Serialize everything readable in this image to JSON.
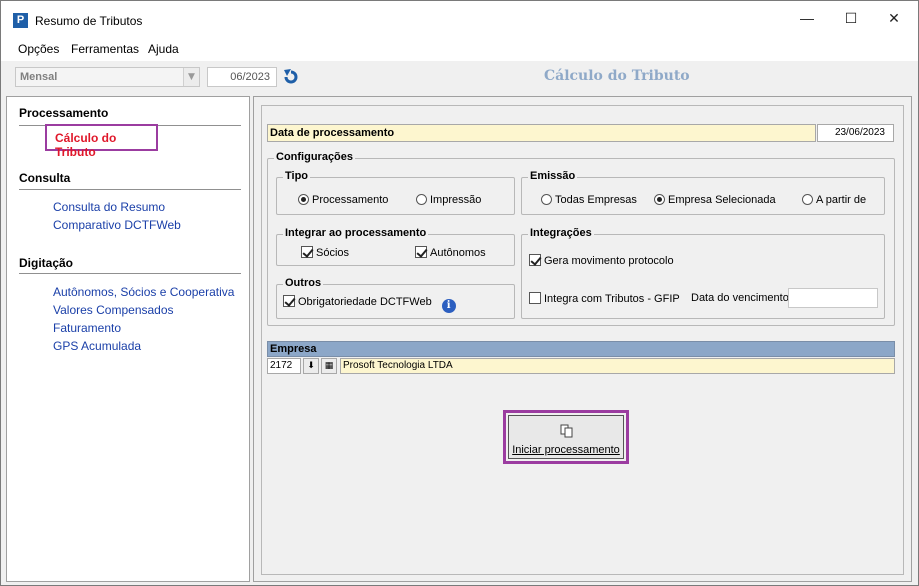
{
  "window": {
    "title": "Resumo de Tributos",
    "app_icon_glyph": "P",
    "minimize_glyph": "—",
    "maximize_glyph": "☐",
    "close_glyph": "✕"
  },
  "menu": [
    "Opções",
    "Ferramentas",
    "Ajuda"
  ],
  "toolbar": {
    "frequency": "Mensal",
    "period": "06/2023",
    "page_title": "Cálculo do Tributo"
  },
  "sidebar": {
    "sections": [
      {
        "title": "Processamento",
        "items": [
          "Cálculo do Tributo"
        ]
      },
      {
        "title": "Consulta",
        "items": [
          "Consulta do Resumo",
          "Comparativo DCTFWeb"
        ]
      },
      {
        "title": "Digitação",
        "items": [
          "Autônomos, Sócios e Cooperativa",
          "Valores Compensados",
          "Faturamento",
          "GPS Acumulada"
        ]
      }
    ],
    "active_item": "Cálculo do Tributo"
  },
  "main": {
    "date_label": "Data de processamento",
    "date_value": "23/06/2023",
    "config_title": "Configurações",
    "tipo": {
      "title": "Tipo",
      "options": [
        "Processamento",
        "Impressão"
      ],
      "selected": "Processamento"
    },
    "emissao": {
      "title": "Emissão",
      "options": [
        "Todas Empresas",
        "Empresa Selecionada",
        "A partir de"
      ],
      "selected": "Empresa Selecionada"
    },
    "integrar": {
      "title": "Integrar ao processamento",
      "socios": "Sócios",
      "autonomos": "Autônomos"
    },
    "integracoes": {
      "title": "Integrações",
      "gera": "Gera movimento protocolo",
      "integra": "Integra com Tributos - GFIP",
      "vencimento_label": "Data do vencimento",
      "vencimento_value": ""
    },
    "outros": {
      "title": "Outros",
      "obrig": "Obrigatoriedade DCTFWeb",
      "info_glyph": "i"
    },
    "empresa": {
      "title": "Empresa",
      "code": "2172",
      "name": "Prosoft Tecnologia LTDA"
    },
    "start_button": "Iniciar processamento"
  },
  "colors": {
    "accent_frame": "#9b3ca0",
    "active_link": "#e0172a",
    "link": "#1a3fa8",
    "yellow_field": "#fdf6cf",
    "header_blue": "#8ca7c8",
    "page_title": "#8fa9c8"
  }
}
